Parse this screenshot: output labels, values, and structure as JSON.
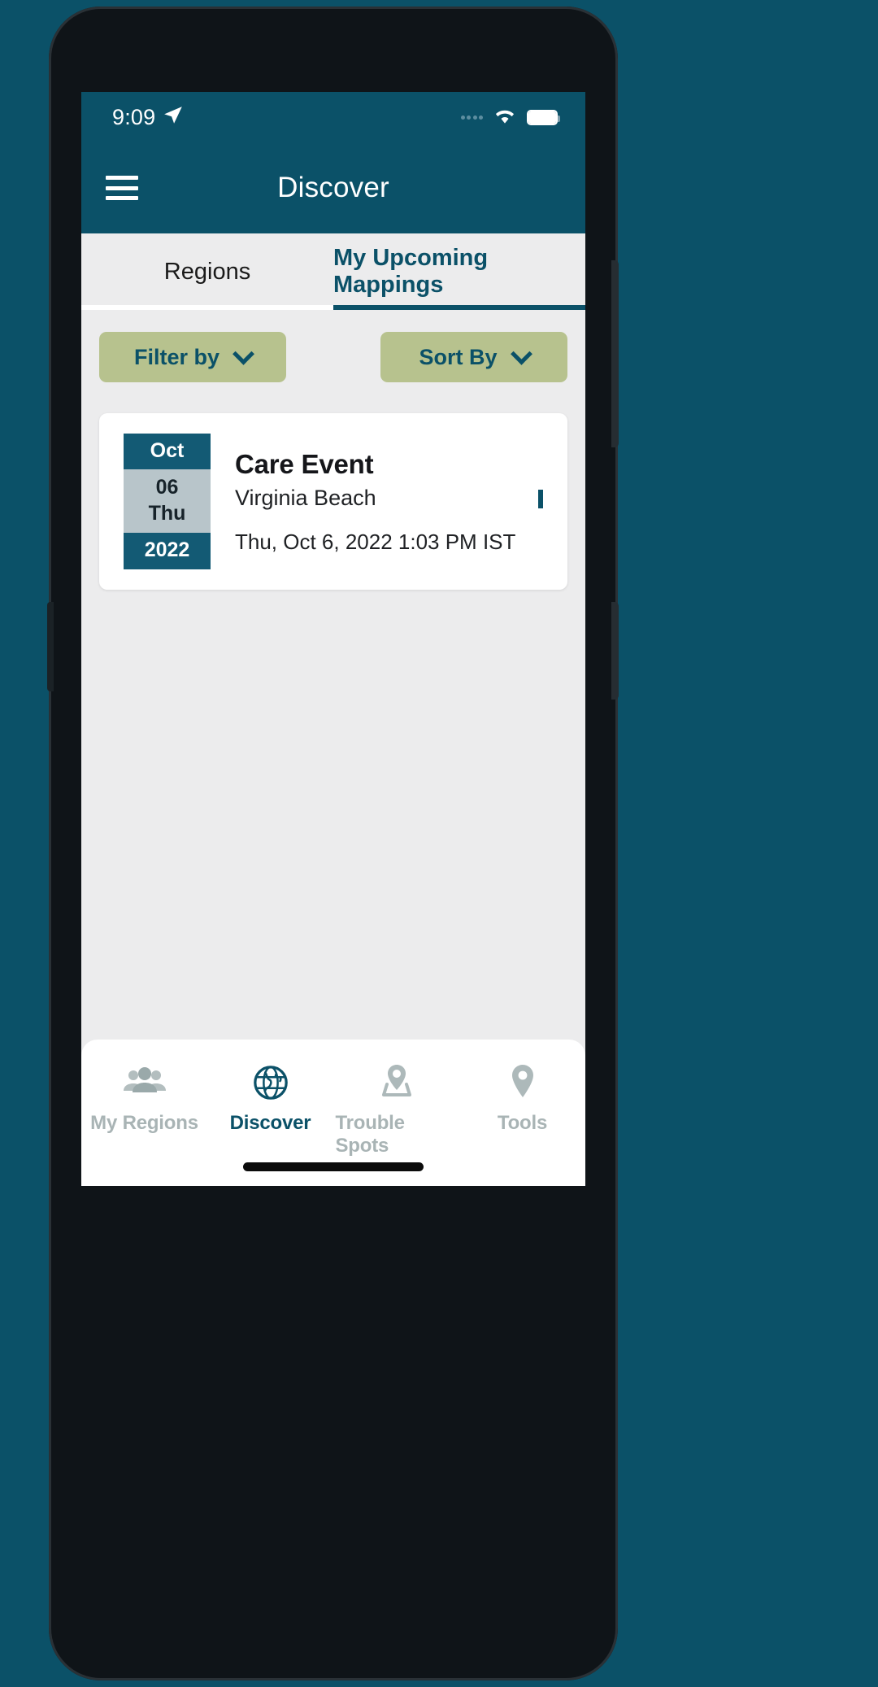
{
  "theme": {
    "background": "#0b5168",
    "header_bg": "#0b5168",
    "accent": "#0b5168",
    "pill_bg": "#b7c28e",
    "screen_bg": "#ececed",
    "card_bg": "#ffffff",
    "date_header_bg": "#135a74",
    "date_body_bg": "#b8c5ca",
    "inactive_nav": "#a9b4b5"
  },
  "statusbar": {
    "time": "9:09",
    "location_icon": "location-arrow-icon",
    "signal_icon": "signal-dots-icon",
    "wifi_icon": "wifi-icon",
    "battery_icon": "battery-full-icon"
  },
  "header": {
    "menu_icon": "hamburger-menu-icon",
    "title": "Discover"
  },
  "tabs": [
    {
      "label": "Regions",
      "active": false
    },
    {
      "label": "My Upcoming Mappings",
      "active": true
    }
  ],
  "controls": {
    "filter": {
      "label": "Filter by",
      "icon": "chevron-down-icon"
    },
    "sort": {
      "label": "Sort By",
      "icon": "chevron-down-icon"
    }
  },
  "events": [
    {
      "date": {
        "month": "Oct",
        "day": "06",
        "weekday": "Thu",
        "year": "2022"
      },
      "title": "Care Event",
      "location": "Virginia Beach",
      "datetime": "Thu, Oct 6, 2022 1:03 PM IST",
      "chevron_icon": "chevron-right-icon"
    }
  ],
  "bottom_nav": [
    {
      "label": "My Regions",
      "icon": "people-group-icon",
      "active": false
    },
    {
      "label": "Discover",
      "icon": "globe-icon",
      "active": true
    },
    {
      "label": "Trouble Spots",
      "icon": "map-pin-base-icon",
      "active": false
    },
    {
      "label": "Tools",
      "icon": "map-pin-icon",
      "active": false
    }
  ]
}
